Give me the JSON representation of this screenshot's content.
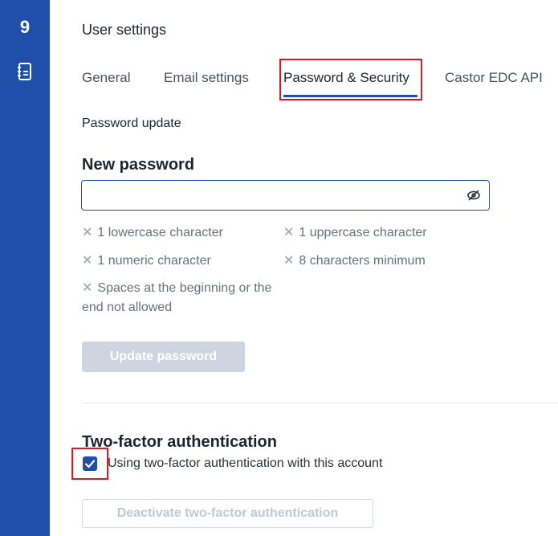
{
  "app": {
    "logo": "9",
    "sidebar_icon": "notebook-icon"
  },
  "page": {
    "title": "User settings"
  },
  "tabs": [
    {
      "label": "General",
      "active": false
    },
    {
      "label": "Email settings",
      "active": false
    },
    {
      "label": "Password & Security",
      "active": true
    },
    {
      "label": "Castor EDC API",
      "active": false
    }
  ],
  "password_update": {
    "section_label": "Password update",
    "heading": "New password",
    "value": "",
    "placeholder": "",
    "visibility_icon": "eye-slash-icon",
    "requirements": [
      "1 lowercase character",
      "1 uppercase character",
      "1 numeric character",
      "8 characters minimum",
      "Spaces at the beginning or the end not allowed"
    ],
    "button_label": "Update password"
  },
  "two_factor": {
    "heading": "Two-factor authentication",
    "checkbox_checked": true,
    "checkbox_label": "Using two-factor authentication with this account",
    "deactivate_label": "Deactivate two-factor authentication"
  },
  "colors": {
    "sidebar": "#1f4fa8",
    "accent": "#1f4fa8",
    "highlight": "#e0141e",
    "disabled_button": "#cfd5e0"
  }
}
